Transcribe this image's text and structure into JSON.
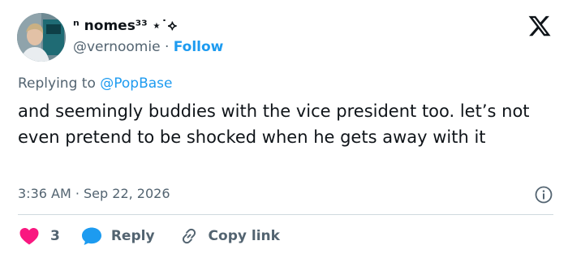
{
  "author": {
    "display_name": "ⁿ nomes³³ ⋆˙⟡",
    "handle": "@vernoomie",
    "separator": "·",
    "follow_label": "Follow",
    "avatar": "profile-photo"
  },
  "reply_context": {
    "prefix": "Replying to",
    "mention": "@PopBase"
  },
  "tweet": {
    "text": "and seemingly buddies with the vice president too. let’s not even pretend to be shocked when he gets away with it"
  },
  "meta": {
    "timestamp": "3:36 AM · Sep 22, 2026"
  },
  "actions": {
    "like_count": "3",
    "reply_label": "Reply",
    "copy_link_label": "Copy link"
  },
  "icons": {
    "brand": "x-logo-icon",
    "info": "info-icon",
    "like": "heart-icon",
    "reply": "chat-bubble-icon",
    "copy": "link-icon"
  },
  "colors": {
    "accent": "#1d9bf0",
    "like": "#f91880",
    "text": "#0f1419",
    "secondary": "#536471",
    "divider": "#cfd9de"
  }
}
